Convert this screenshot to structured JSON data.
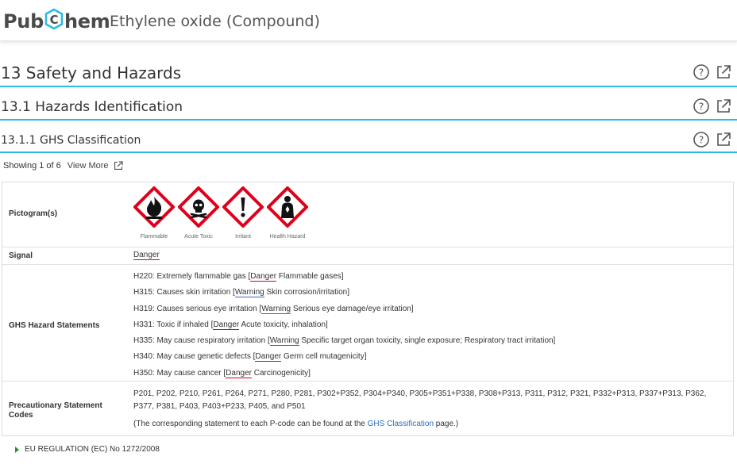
{
  "header": {
    "logo_left": "Pub",
    "logo_hex_letter": "C",
    "logo_right": "hem",
    "compound_title": "Ethylene oxide (Compound)"
  },
  "sections": {
    "s13": "13  Safety and Hazards",
    "s13_1": "13.1  Hazards Identification",
    "s13_1_1": "13.1.1  GHS Classification"
  },
  "toolbar": {
    "help_icon": "help-circle-icon",
    "popout_icon": "external-link-icon"
  },
  "showing": {
    "text": "Showing 1 of 6",
    "view_more": "View More"
  },
  "colors": {
    "accent": "#2bbce0",
    "danger": "#d0021b",
    "warning": "#2a6ebb",
    "ghs_red": "#e0001b"
  },
  "table": {
    "pictogram_label": "Pictogram(s)",
    "pictograms": [
      {
        "name": "Flammable",
        "icon": "ghs-flame-icon"
      },
      {
        "name": "Acute Toxic",
        "icon": "ghs-skull-icon"
      },
      {
        "name": "Irritant",
        "icon": "ghs-exclamation-icon"
      },
      {
        "name": "Health Hazard",
        "icon": "ghs-health-hazard-icon"
      }
    ],
    "signal_label": "Signal",
    "signal_value": "Danger",
    "hazard_label": "GHS Hazard Statements",
    "hazards": [
      {
        "code": "H220: Extremely flammable gas [",
        "signal": "Danger",
        "rest": " Flammable gases]"
      },
      {
        "code": "H315: Causes skin irritation [",
        "signal": "Warning",
        "rest": " Skin corrosion/irritation]"
      },
      {
        "code": "H319: Causes serious eye irritation [",
        "signal": "Warning",
        "rest": " Serious eye damage/eye irritation]"
      },
      {
        "code": "H331: Toxic if inhaled [",
        "signal": "Danger",
        "rest": " Acute toxicity, inhalation]"
      },
      {
        "code": "H335: May cause respiratory irritation [",
        "signal": "Warning",
        "rest": " Specific target organ toxicity, single exposure; Respiratory tract irritation]"
      },
      {
        "code": "H340: May cause genetic defects [",
        "signal": "Danger",
        "rest": " Germ cell mutagenicity]"
      },
      {
        "code": "H350: May cause cancer [",
        "signal": "Danger",
        "rest": " Carcinogenicity]"
      }
    ],
    "prec_label": "Precautionary Statement Codes",
    "prec_codes": "P201, P202, P210, P261, P264, P271, P280, P281, P302+P352, P304+P340, P305+P351+P338, P308+P313, P311, P312, P321, P332+P313, P337+P313, P362, P377, P381, P403, P403+P233, P405, and P501",
    "prec_note_before": "(The corresponding statement to each P-code can be found at the ",
    "prec_note_link": "GHS Classification",
    "prec_note_after": " page.)"
  },
  "footer": {
    "eu_regulation": "EU REGULATION (EC) No 1272/2008"
  }
}
